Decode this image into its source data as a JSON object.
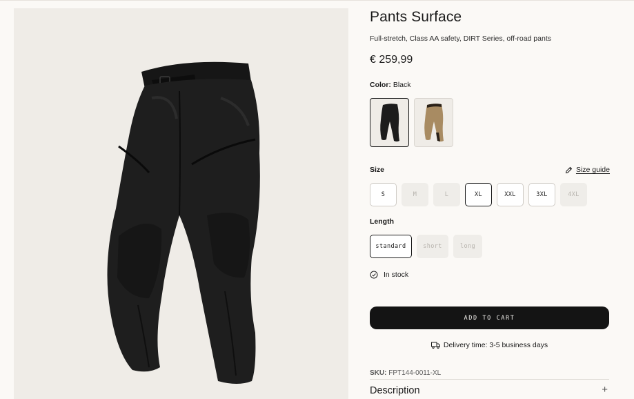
{
  "product": {
    "title": "Pants Surface",
    "subtitle": "Full-stretch, Class AA safety, DIRT Series, off-road pants",
    "price": "€ 259,99"
  },
  "color": {
    "label": "Color:",
    "selected": "Black",
    "swatches": [
      {
        "name": "Black",
        "hex": "#1c1c1c",
        "selected": true
      },
      {
        "name": "Sand",
        "hex": "#a88b62",
        "selected": false
      }
    ]
  },
  "size": {
    "label": "Size",
    "guide_label": "Size guide",
    "guide_icon": "pencil-ruler-icon",
    "options": [
      {
        "label": "S",
        "available": true,
        "selected": false
      },
      {
        "label": "M",
        "available": false,
        "selected": false
      },
      {
        "label": "L",
        "available": false,
        "selected": false
      },
      {
        "label": "XL",
        "available": true,
        "selected": true
      },
      {
        "label": "XXL",
        "available": true,
        "selected": false
      },
      {
        "label": "3XL",
        "available": true,
        "selected": false
      },
      {
        "label": "4XL",
        "available": false,
        "selected": false
      }
    ]
  },
  "length": {
    "label": "Length",
    "options": [
      {
        "label": "standard",
        "available": true,
        "selected": true
      },
      {
        "label": "short",
        "available": false,
        "selected": false
      },
      {
        "label": "long",
        "available": false,
        "selected": false
      }
    ]
  },
  "stock": {
    "icon": "check-circle-icon",
    "text": "In stock"
  },
  "cart": {
    "label": "ADD TO CART"
  },
  "delivery": {
    "icon": "truck-icon",
    "text": "Delivery time: 3-5 business days"
  },
  "sku": {
    "label": "SKU:",
    "value": "FPT144-0011-XL"
  },
  "description": {
    "label": "Description",
    "icon": "plus-icon"
  },
  "colors": {
    "background": "#fbf9f6",
    "image_bg": "#efece7",
    "cart_bg": "#141414",
    "disabled_chip": "#efede9"
  }
}
